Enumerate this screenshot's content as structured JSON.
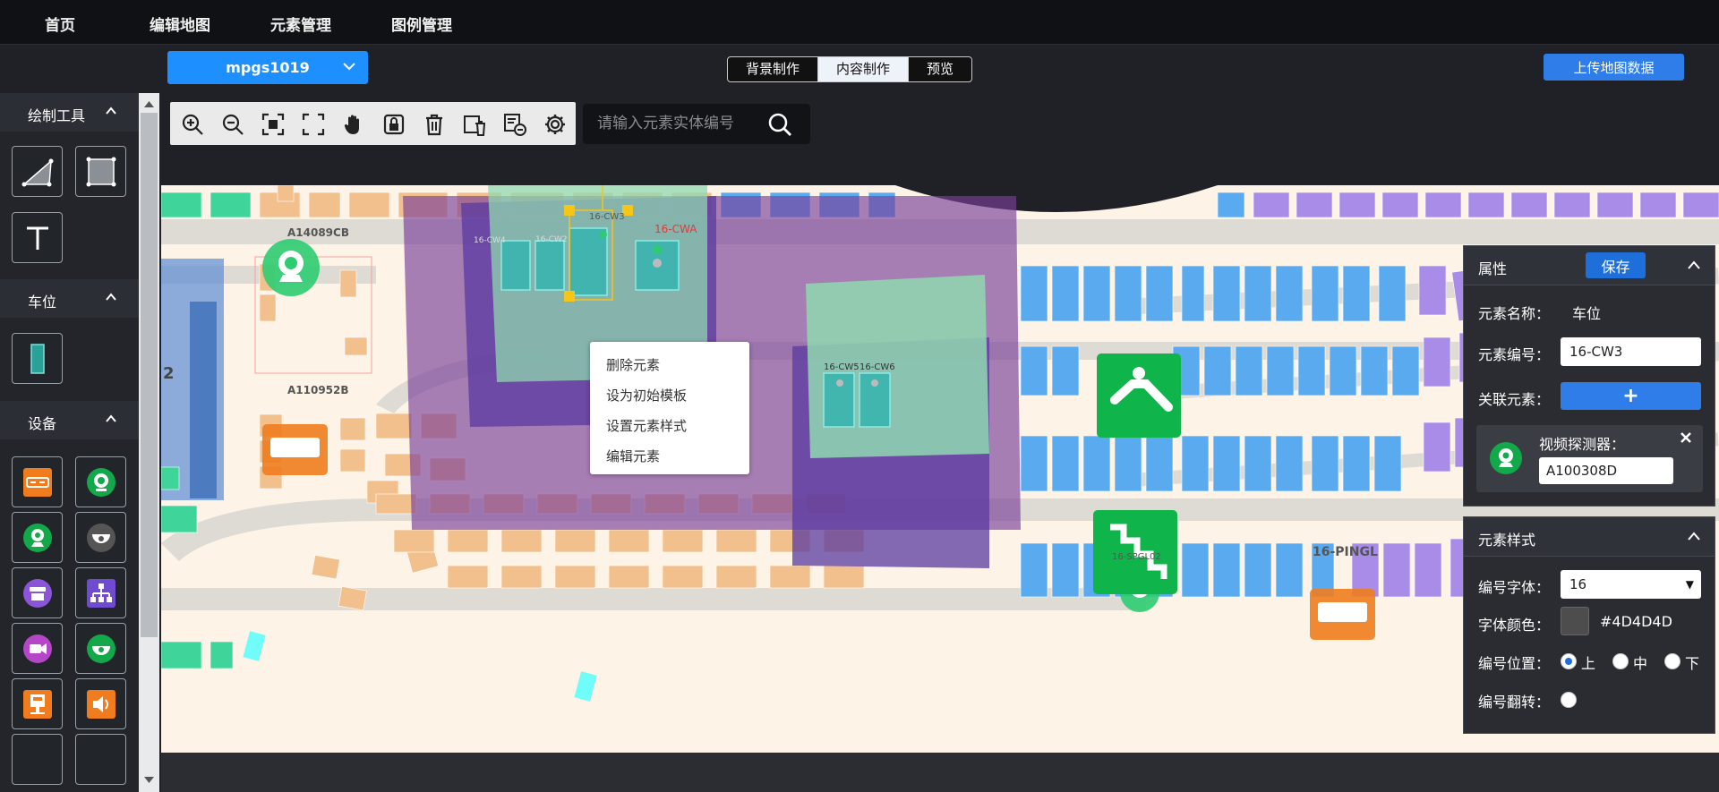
{
  "nav": {
    "items": [
      "首页",
      "编辑地图",
      "元素管理",
      "图例管理"
    ]
  },
  "map_select": {
    "value": "mpgs1019"
  },
  "mode_tabs": {
    "items": [
      "背景制作",
      "内容制作",
      "预览"
    ],
    "active": "内容制作"
  },
  "upload_button": "上传地图数据",
  "sidebar": {
    "sections": [
      {
        "title": "绘制工具"
      },
      {
        "title": "车位"
      },
      {
        "title": "设备"
      }
    ]
  },
  "search": {
    "placeholder": "请输入元素实体编号"
  },
  "context_menu": {
    "items": [
      "删除元素",
      "设为初始模板",
      "设置元素样式",
      "编辑元素"
    ]
  },
  "map_labels": {
    "a1": "A14089CB",
    "a2": "A110952B",
    "n16cw4": "16-CW4",
    "n16cw2": "16-CW2",
    "n16cw3": "16-CW3",
    "n16cw5": "16-CW5",
    "n16cw6": "16-CW6",
    "spg": "16-SPGL02",
    "ping": "16-PINGL",
    "two": "2"
  },
  "props_panel": {
    "title": "属性",
    "save_label": "保存",
    "name_label": "元素名称：",
    "name_value": "车位",
    "code_label": "元素编号：",
    "code_value": "16-CW3",
    "link_label": "关联元素：",
    "link_add": "+",
    "linked": {
      "label": "视频探测器：",
      "value": "A100308D"
    }
  },
  "style_panel": {
    "title": "元素样式",
    "font_label": "编号字体：",
    "font_value": "16",
    "color_label": "字体颜色：",
    "color_value": "#4D4D4D",
    "position_label": "编号位置：",
    "position_options": [
      "上",
      "中",
      "下"
    ],
    "position_selected": "上",
    "flip_label": "编号翻转："
  },
  "colors": {
    "accent_blue": "#1e8fff",
    "purple_zone": "#7a3f9a",
    "green_zone": "#8fd8b0",
    "lot_blue": "#5aaaf0",
    "lot_purple": "#a98be8",
    "lot_orange": "#f2c08c",
    "lot_green": "#3ed49a",
    "sign_green": "#0fb54a"
  }
}
